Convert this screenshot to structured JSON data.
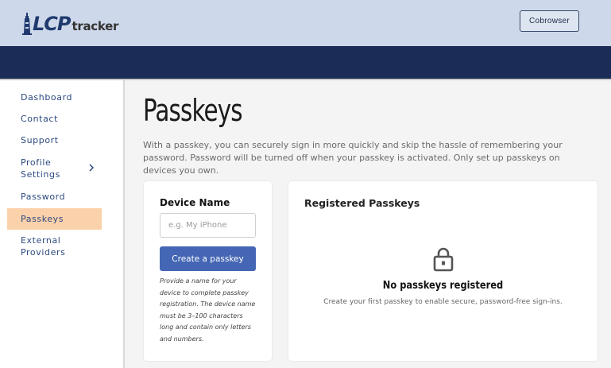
{
  "header": {
    "logo_lcp": "LCP",
    "logo_tracker": "tracker",
    "cobrowser_label": "Cobrowser"
  },
  "sidebar": {
    "items": [
      {
        "label": "Dashboard"
      },
      {
        "label": "Contact"
      },
      {
        "label": "Support"
      },
      {
        "label": "Profile\nSettings"
      },
      {
        "label": "Password"
      },
      {
        "label": "Passkeys"
      },
      {
        "label": "External\nProviders"
      }
    ],
    "active": "Passkeys"
  },
  "main": {
    "title": "Passkeys",
    "description": "With a passkey, you can securely sign in more quickly and skip the hassle of remembering your password. Password will be turned off when your passkey is activated. Only set up passkeys on devices you own.",
    "device_form": {
      "label": "Device Name",
      "placeholder": "e.g. My iPhone",
      "value": "",
      "button_label": "Create a passkey",
      "help_text": "Provide a name for your device to complete passkey registration. The device name must be 3–100 characters long and contain only letters and numbers."
    },
    "registered": {
      "title": "Registered Passkeys",
      "empty_title": "No passkeys registered",
      "empty_subtitle": "Create your first passkey to enable secure, password-free sign-ins.",
      "icon": "lock-icon"
    }
  },
  "colors": {
    "header_bg": "#cdd8ea",
    "nav_bg": "#1b2c56",
    "accent": "#4466b4",
    "active_item_bg": "#fbd1ab",
    "link": "#2c4a80"
  }
}
